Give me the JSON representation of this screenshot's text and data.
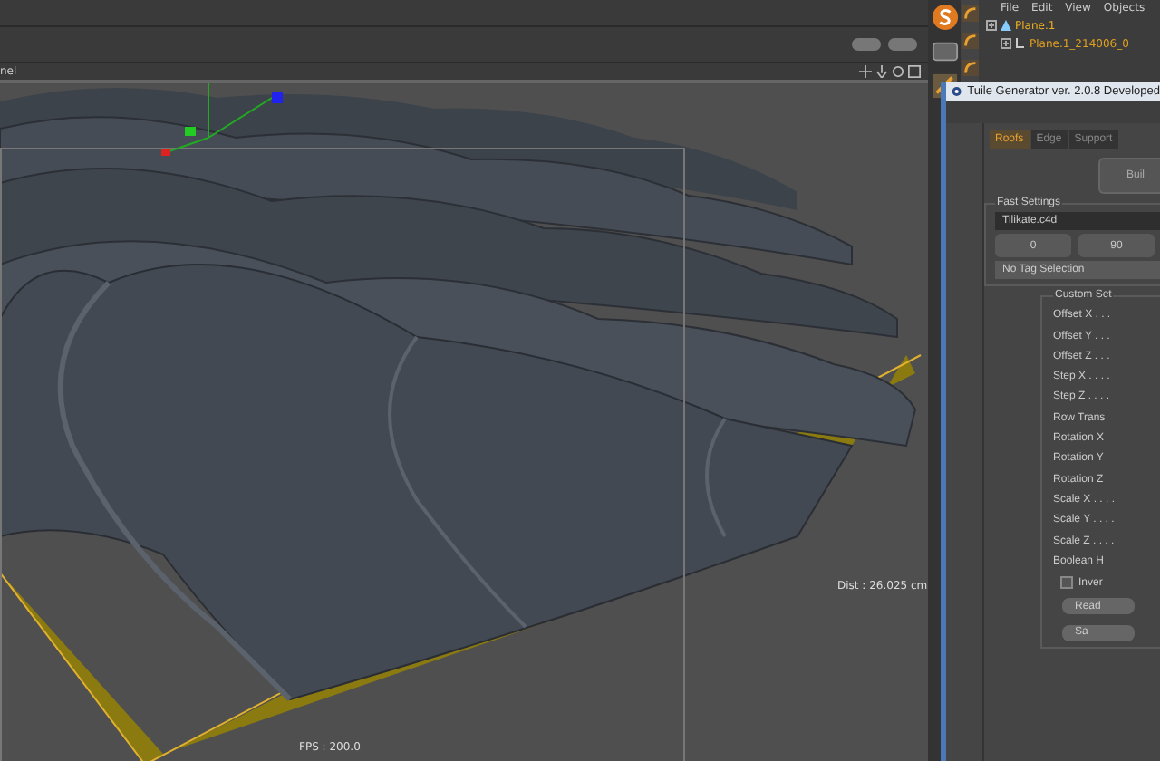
{
  "viewport": {
    "title": "nel",
    "dist": "Dist : 26.025 cm",
    "fps": "FPS : 200.0"
  },
  "object_manager": {
    "menu": [
      "File",
      "Edit",
      "View",
      "Objects"
    ],
    "objects": [
      {
        "name": "Plane.1",
        "children": [
          {
            "name": "Plane.1_214006_0"
          }
        ]
      }
    ]
  },
  "dialog": {
    "title": "Tuile Generator ver. 2.0.8 Developed",
    "tabs": [
      {
        "label": "Roofs",
        "selected": true
      },
      {
        "label": "Edge",
        "selected": false
      },
      {
        "label": "Support",
        "selected": false
      }
    ],
    "build_button": "Buil",
    "fast_settings": {
      "title": "Fast Settings",
      "file": "Tilikate.c4d",
      "buttons": [
        "0",
        "90"
      ],
      "tag": "No Tag Selection"
    },
    "custom_settings": {
      "title": "Custom Set",
      "fields": [
        "Offset X . . .",
        "Offset Y . . .",
        "Offset Z . . .",
        "Step X . . . .",
        "Step Z . . . .",
        "Row Trans",
        "Rotation X",
        "Rotation Y",
        "Rotation Z",
        "Scale X . . . .",
        "Scale Y . . . .",
        "Scale Z . . . .",
        "Boolean H"
      ]
    },
    "invert": {
      "label": "Inver",
      "checked": false
    },
    "buttons": [
      "Read",
      "Sa"
    ]
  }
}
